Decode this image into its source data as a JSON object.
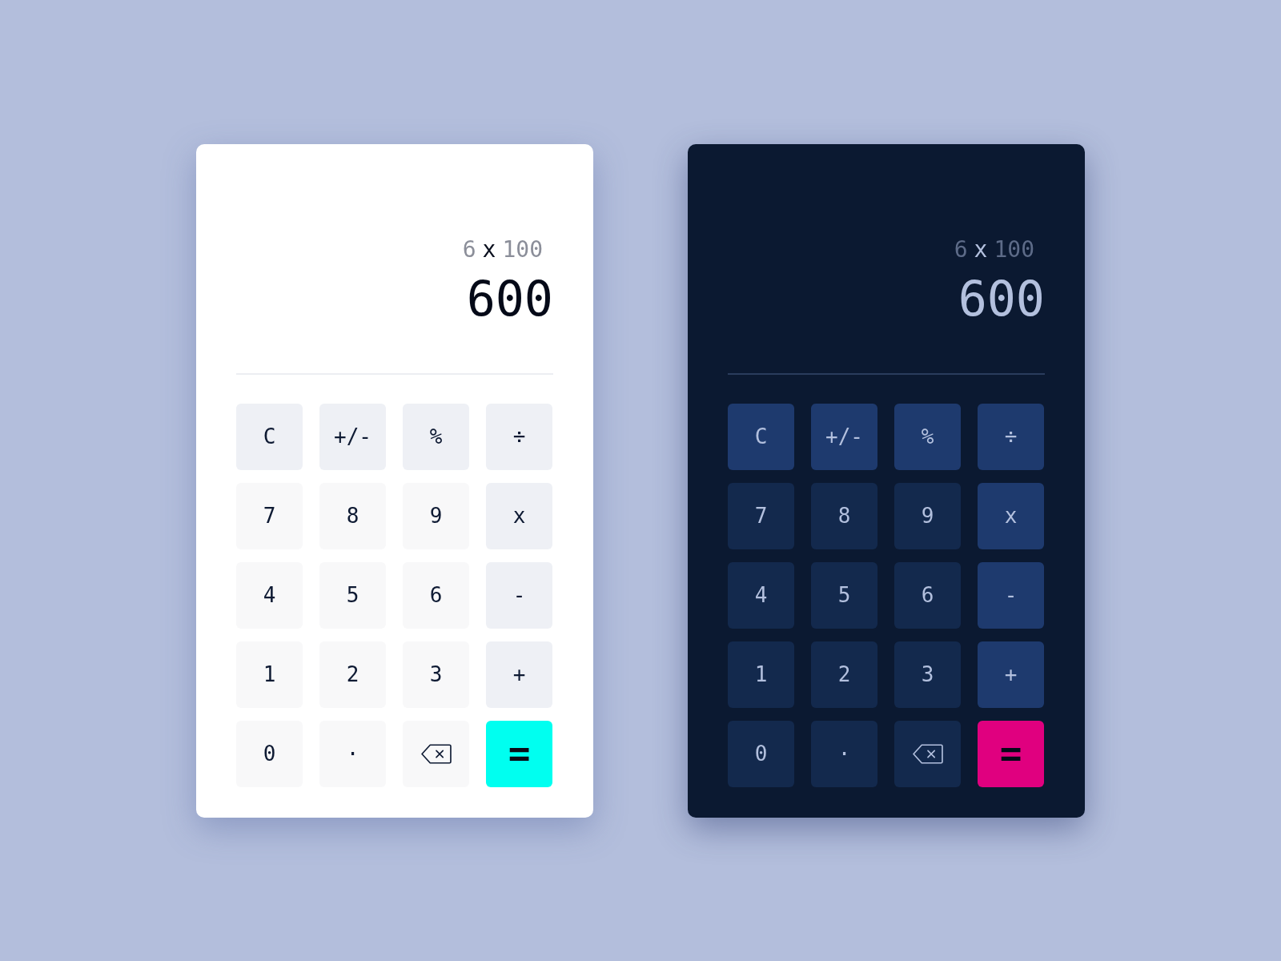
{
  "calculators": [
    {
      "kind": "light",
      "expression": [
        {
          "kind": "operand",
          "text": "6"
        },
        {
          "kind": "operator",
          "text": "x"
        },
        {
          "kind": "operand",
          "text": "100"
        }
      ],
      "result": "600",
      "keys": [
        {
          "kind": "function",
          "label": "C"
        },
        {
          "kind": "function",
          "label": "+/-"
        },
        {
          "kind": "function",
          "label": "%"
        },
        {
          "kind": "operator",
          "label": "÷"
        },
        {
          "kind": "digit",
          "label": "7"
        },
        {
          "kind": "digit",
          "label": "8"
        },
        {
          "kind": "digit",
          "label": "9"
        },
        {
          "kind": "operator",
          "label": "x"
        },
        {
          "kind": "digit",
          "label": "4"
        },
        {
          "kind": "digit",
          "label": "5"
        },
        {
          "kind": "digit",
          "label": "6"
        },
        {
          "kind": "operator",
          "label": "-"
        },
        {
          "kind": "digit",
          "label": "1"
        },
        {
          "kind": "digit",
          "label": "2"
        },
        {
          "kind": "digit",
          "label": "3"
        },
        {
          "kind": "operator",
          "label": "+"
        },
        {
          "kind": "digit",
          "label": "0"
        },
        {
          "kind": "digit",
          "label": "·"
        },
        {
          "kind": "backspace"
        },
        {
          "kind": "equals",
          "label": "="
        }
      ]
    },
    {
      "kind": "dark",
      "expression": [
        {
          "kind": "operand",
          "text": "6"
        },
        {
          "kind": "operator",
          "text": "x"
        },
        {
          "kind": "operand",
          "text": "100"
        }
      ],
      "result": "600",
      "keys": [
        {
          "kind": "function",
          "label": "C"
        },
        {
          "kind": "function",
          "label": "+/-"
        },
        {
          "kind": "function",
          "label": "%"
        },
        {
          "kind": "operator",
          "label": "÷"
        },
        {
          "kind": "digit",
          "label": "7"
        },
        {
          "kind": "digit",
          "label": "8"
        },
        {
          "kind": "digit",
          "label": "9"
        },
        {
          "kind": "operator",
          "label": "x"
        },
        {
          "kind": "digit",
          "label": "4"
        },
        {
          "kind": "digit",
          "label": "5"
        },
        {
          "kind": "digit",
          "label": "6"
        },
        {
          "kind": "operator",
          "label": "-"
        },
        {
          "kind": "digit",
          "label": "1"
        },
        {
          "kind": "digit",
          "label": "2"
        },
        {
          "kind": "digit",
          "label": "3"
        },
        {
          "kind": "operator",
          "label": "+"
        },
        {
          "kind": "digit",
          "label": "0"
        },
        {
          "kind": "digit",
          "label": "·"
        },
        {
          "kind": "backspace"
        },
        {
          "kind": "equals",
          "label": "="
        }
      ]
    }
  ]
}
